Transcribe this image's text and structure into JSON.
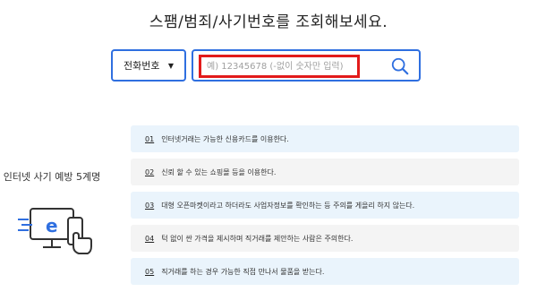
{
  "title": "스팸/범죄/사기번호를 조회해보세요.",
  "search": {
    "type_selected": "전화번호",
    "placeholder": "예) 12345678 (-없이 숫자만 입력)",
    "value": ""
  },
  "left_panel": {
    "caption": "인터넷 사기 예방 5계명"
  },
  "tips": [
    {
      "num": "01",
      "text": "인터넷거래는 가능한 신용카드를 이용한다."
    },
    {
      "num": "02",
      "text": "신뢰 할 수 있는 쇼핑몰 등을 이용한다."
    },
    {
      "num": "03",
      "text": "대형 오픈마켓이라고 하더라도 사업자정보를 확인하는 등 주의를 게을리 하지 않는다."
    },
    {
      "num": "04",
      "text": "턱 없이 싼 가격을 제시하며 직거래를 제안하는 사람은 주의한다."
    },
    {
      "num": "05",
      "text": "직거래를 하는 경우 가능한 직접 만나서 물품을 받는다."
    }
  ],
  "colors": {
    "accent": "#2f6fe0",
    "highlight_outline": "#e21b1b",
    "tip_bg_blue": "#eaf4fc",
    "tip_bg_gray": "#f4f4f4"
  },
  "icons": {
    "search": "search-icon",
    "select_caret": "caret-down-icon",
    "illustration": "computer-phone-illustration"
  }
}
